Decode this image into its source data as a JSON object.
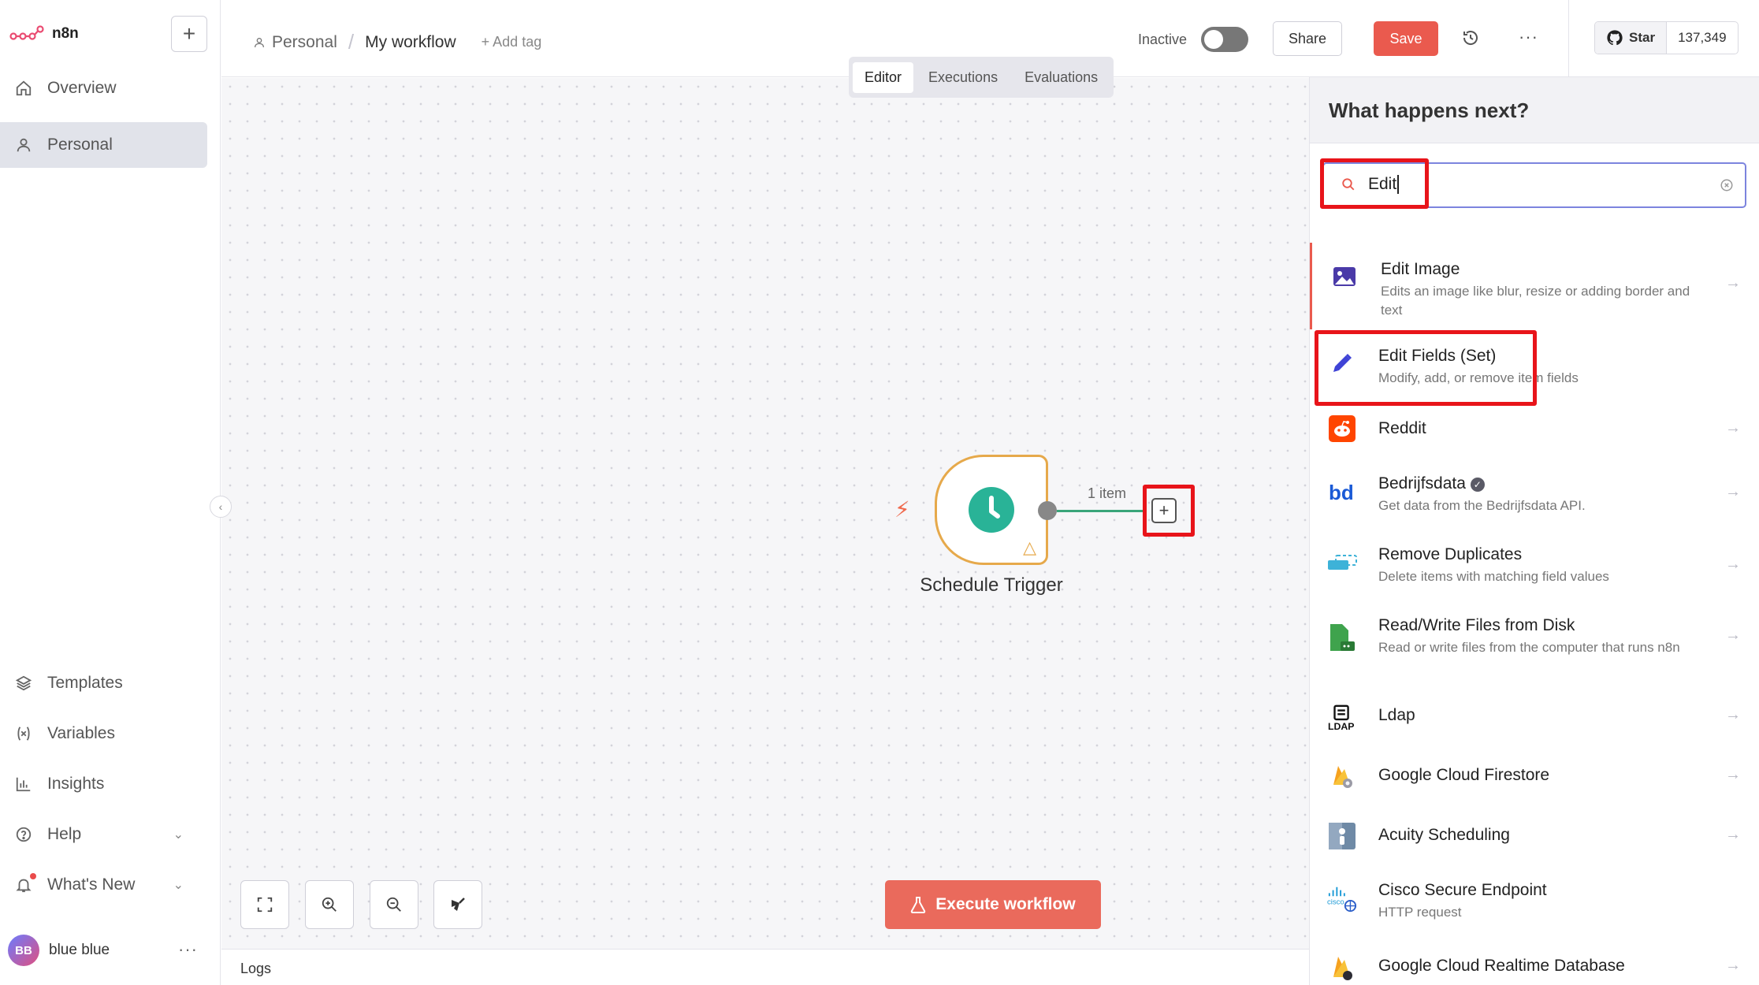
{
  "sidebar": {
    "logo_text": "n8n",
    "new_button": "+",
    "items": [
      {
        "label": "Overview"
      },
      {
        "label": "Personal"
      },
      {
        "label": "Templates"
      },
      {
        "label": "Variables"
      },
      {
        "label": "Insights"
      },
      {
        "label": "Help"
      },
      {
        "label": "What's New"
      }
    ],
    "user": {
      "initials": "BB",
      "name": "blue blue"
    }
  },
  "header": {
    "breadcrumb_project": "Personal",
    "breadcrumb_sep": "/",
    "workflow_name": "My workflow",
    "add_tag": "+ Add tag",
    "status": "Inactive",
    "share": "Share",
    "save": "Save",
    "github_star": "Star",
    "github_count": "137,349"
  },
  "tabs": [
    "Editor",
    "Executions",
    "Evaluations"
  ],
  "canvas": {
    "node_label": "Schedule Trigger",
    "connection_label": "1 item",
    "execute_button": "Execute workflow",
    "logs_label": "Logs"
  },
  "panel": {
    "title": "What happens next?",
    "search_value": "Edit",
    "results": [
      {
        "title": "Edit Image",
        "desc": "Edits an image like blur, resize or adding border and text",
        "icon": "image-icon"
      },
      {
        "title": "Edit Fields (Set)",
        "desc": "Modify, add, or remove item fields",
        "icon": "pencil-icon"
      },
      {
        "title": "Reddit",
        "desc": "",
        "icon": "reddit-icon"
      },
      {
        "title": "Bedrijfsdata",
        "desc": "Get data from the Bedrijfsdata API.",
        "icon": "bedrijfsdata-icon"
      },
      {
        "title": "Remove Duplicates",
        "desc": "Delete items with matching field values",
        "icon": "remove-duplicates-icon"
      },
      {
        "title": "Read/Write Files from Disk",
        "desc": "Read or write files from the computer that runs n8n",
        "icon": "file-icon"
      },
      {
        "title": "Ldap",
        "desc": "",
        "icon": "ldap-icon"
      },
      {
        "title": "Google Cloud Firestore",
        "desc": "",
        "icon": "firestore-icon"
      },
      {
        "title": "Acuity Scheduling",
        "desc": "",
        "icon": "acuity-icon"
      },
      {
        "title": "Cisco Secure Endpoint",
        "desc": "HTTP request",
        "icon": "cisco-icon"
      },
      {
        "title": "Google Cloud Realtime Database",
        "desc": "",
        "icon": "firebase-icon"
      }
    ]
  },
  "colors": {
    "accent": "#ea5a4e",
    "highlight": "#e8141a",
    "trigger_green": "#29b397",
    "node_border": "#e6a94b"
  }
}
